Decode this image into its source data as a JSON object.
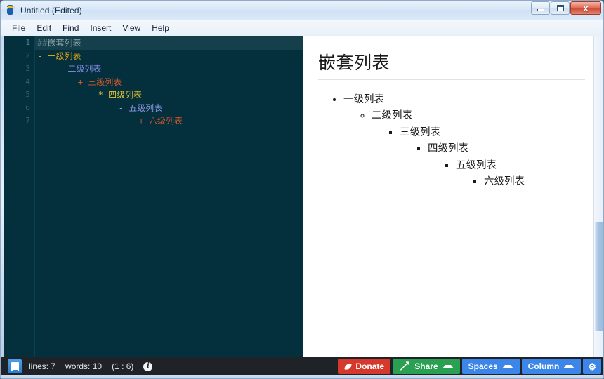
{
  "window": {
    "title": "Untitled (Edited)",
    "icon": "app-icon",
    "controls": {
      "minimize": "minimize-button",
      "maximize": "maximize-button",
      "close_glyph": "x"
    }
  },
  "menubar": {
    "items": [
      {
        "label": "File"
      },
      {
        "label": "Edit"
      },
      {
        "label": "Find"
      },
      {
        "label": "Insert"
      },
      {
        "label": "View"
      },
      {
        "label": "Help"
      }
    ]
  },
  "editor": {
    "background": "#042f3d",
    "active_line": 1,
    "gutter": [
      "1",
      "2",
      "3",
      "4",
      "5",
      "6",
      "7"
    ],
    "lines": [
      {
        "n": "1",
        "indent": "",
        "marker": "##",
        "marker_class": "tok-hash",
        "text": "嵌套列表",
        "text_class": "tok-head",
        "active": true
      },
      {
        "n": "2",
        "indent": "",
        "marker": "-",
        "marker_class": "tok-gold",
        "text": "一级列表",
        "text_class": "tok-gold",
        "active": false
      },
      {
        "n": "3",
        "indent": "    ",
        "marker": "-",
        "marker_class": "tok-blue",
        "text": "二级列表",
        "text_class": "tok-blue",
        "active": false
      },
      {
        "n": "4",
        "indent": "        ",
        "marker": "+",
        "marker_class": "tok-orange",
        "text": "三级列表",
        "text_class": "tok-orange",
        "active": false
      },
      {
        "n": "5",
        "indent": "            ",
        "marker": "*",
        "marker_class": "tok-yellow",
        "text": "四级列表",
        "text_class": "tok-yellow",
        "active": false
      },
      {
        "n": "6",
        "indent": "                ",
        "marker": "-",
        "marker_class": "tok-ltblue",
        "text": "五级列表",
        "text_class": "tok-ltblue",
        "active": false
      },
      {
        "n": "7",
        "indent": "                    ",
        "marker": "+",
        "marker_class": "tok-orange",
        "text": "六级列表",
        "text_class": "tok-orange",
        "active": false
      }
    ]
  },
  "preview": {
    "heading": "嵌套列表",
    "list": {
      "level1": "一级列表",
      "level2": "二级列表",
      "level3": "三级列表",
      "level4": "四级列表",
      "level5": "五级列表",
      "level6": "六级列表"
    }
  },
  "statusbar": {
    "lines_label": "lines: 7",
    "words_label": "words: 10",
    "position_label": "(1 : 6)",
    "info_glyph": "i",
    "buttons": {
      "donate": "Donate",
      "share": "Share",
      "spaces": "Spaces",
      "column": "Column",
      "gear_glyph": "⚙"
    },
    "colors": {
      "donate": "#d6392b",
      "share": "#2aa152",
      "blue": "#3b86e8"
    }
  }
}
